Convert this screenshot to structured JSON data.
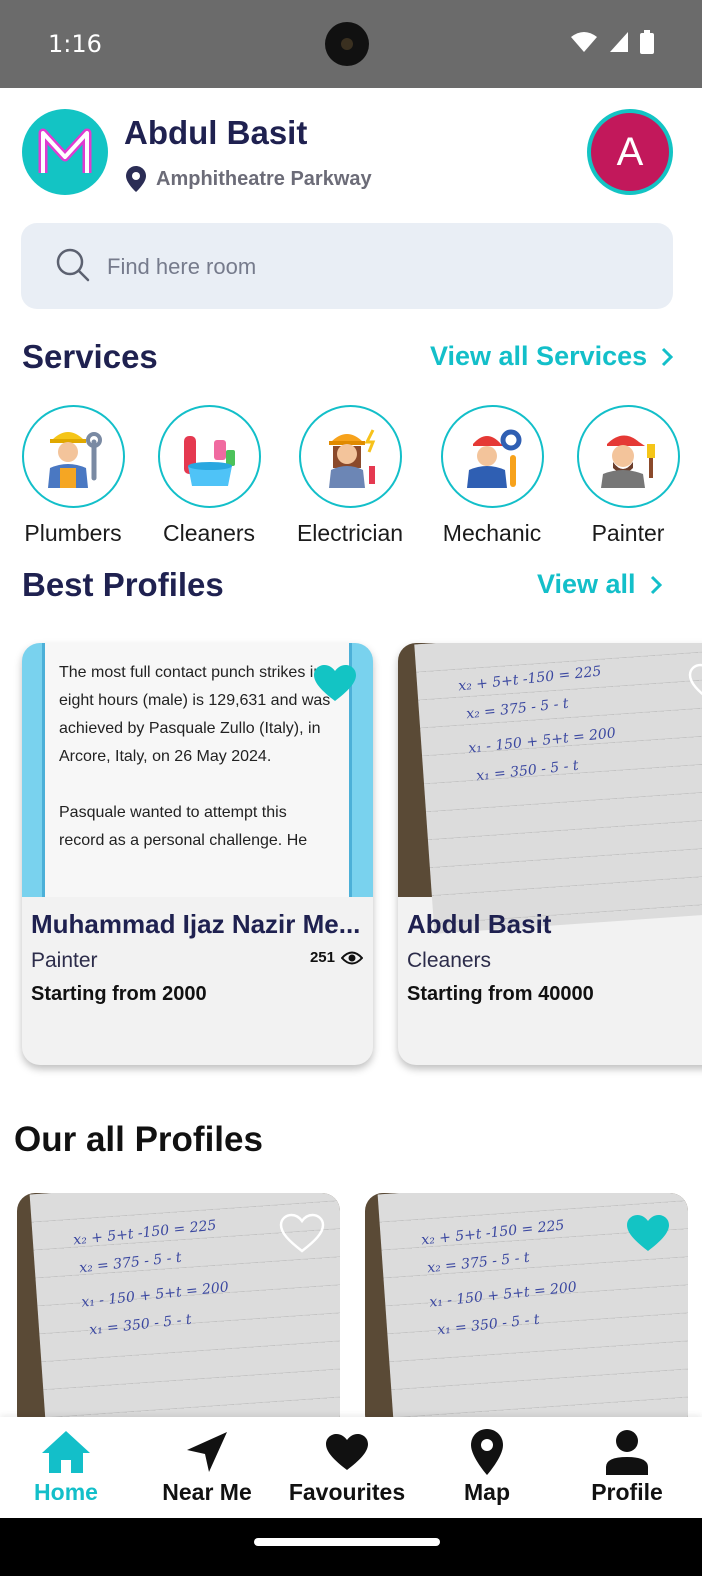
{
  "status_bar": {
    "time": "1:16"
  },
  "header": {
    "user_name": "Abdul Basit",
    "location": "Amphitheatre Parkway",
    "avatar_letter": "A",
    "brand_color": "#13c4c4",
    "avatar_color": "#c2185b"
  },
  "search": {
    "placeholder": "Find here room"
  },
  "services_section": {
    "title": "Services",
    "view_all_label": "View all Services",
    "items": [
      {
        "label": "Plumbers",
        "icon": "plumber-icon"
      },
      {
        "label": "Cleaners",
        "icon": "cleaner-icon"
      },
      {
        "label": "Electrician",
        "icon": "electrician-icon"
      },
      {
        "label": "Mechanic",
        "icon": "mechanic-icon"
      },
      {
        "label": "Painter",
        "icon": "painter-icon"
      }
    ]
  },
  "best_profiles_section": {
    "title": "Best Profiles",
    "view_all_label": "View all",
    "cards": [
      {
        "name": "Muhammad Ijaz Nazir Me...",
        "category": "Painter",
        "price": "Starting from 2000",
        "views": "251",
        "favourited": true,
        "image_text_p1": "The most full contact punch strikes in eight hours (male) is 129,631 and was achieved by Pasquale Zullo (Italy), in Arcore, Italy, on 26 May 2024.",
        "image_text_p2": "Pasquale wanted to attempt this record as a personal challenge. He"
      },
      {
        "name": "Abdul Basit",
        "category": "Cleaners",
        "price": "Starting from 40000",
        "favourited": false
      }
    ]
  },
  "all_profiles_section": {
    "title": "Our all Profiles",
    "cards": [
      {
        "favourited": false
      },
      {
        "favourited": true
      }
    ]
  },
  "notebook_lines": [
    "x₂ + 5+t -150 = 225",
    "x₂ = 375 - 5 - t",
    "x₁ - 150 + 5+t = 200",
    "x₁ = 350 - 5 - t"
  ],
  "bottom_nav": {
    "items": [
      {
        "label": "Home",
        "icon": "home-icon",
        "active": true
      },
      {
        "label": "Near Me",
        "icon": "navigation-arrow-icon"
      },
      {
        "label": "Favourites",
        "icon": "heart-icon"
      },
      {
        "label": "Map",
        "icon": "map-pin-icon"
      },
      {
        "label": "Profile",
        "icon": "person-icon"
      }
    ],
    "active_color": "#13bfc9"
  }
}
